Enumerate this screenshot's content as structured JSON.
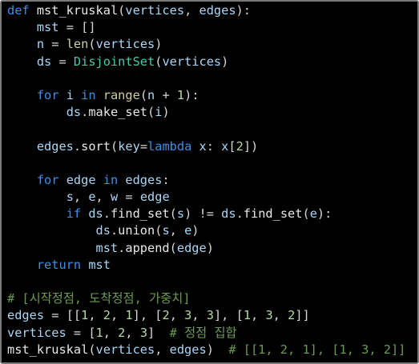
{
  "editor": {
    "lines": [
      [
        [
          "kw",
          "def "
        ],
        [
          "fn",
          "mst_kruskal"
        ],
        [
          "op",
          "("
        ],
        [
          "id",
          "vertices"
        ],
        [
          "op",
          ", "
        ],
        [
          "id",
          "edges"
        ],
        [
          "op",
          "):"
        ]
      ],
      [
        [
          "op",
          "    "
        ],
        [
          "id",
          "mst"
        ],
        [
          "op",
          " = []"
        ]
      ],
      [
        [
          "op",
          "    "
        ],
        [
          "id",
          "n"
        ],
        [
          "op",
          " = "
        ],
        [
          "bi",
          "len"
        ],
        [
          "op",
          "("
        ],
        [
          "id",
          "vertices"
        ],
        [
          "op",
          ")"
        ]
      ],
      [
        [
          "op",
          "    "
        ],
        [
          "id",
          "ds"
        ],
        [
          "op",
          " = "
        ],
        [
          "cls",
          "DisjointSet"
        ],
        [
          "op",
          "("
        ],
        [
          "id",
          "vertices"
        ],
        [
          "op",
          ")"
        ]
      ],
      [],
      [
        [
          "op",
          "    "
        ],
        [
          "kw",
          "for "
        ],
        [
          "id",
          "i"
        ],
        [
          "kw",
          " in "
        ],
        [
          "bi",
          "range"
        ],
        [
          "op",
          "("
        ],
        [
          "id",
          "n"
        ],
        [
          "op",
          " + "
        ],
        [
          "num",
          "1"
        ],
        [
          "op",
          "):"
        ]
      ],
      [
        [
          "op",
          "        "
        ],
        [
          "id",
          "ds"
        ],
        [
          "op",
          "."
        ],
        [
          "fn",
          "make_set"
        ],
        [
          "op",
          "("
        ],
        [
          "id",
          "i"
        ],
        [
          "op",
          ")"
        ]
      ],
      [],
      [
        [
          "op",
          "    "
        ],
        [
          "id",
          "edges"
        ],
        [
          "op",
          "."
        ],
        [
          "fn",
          "sort"
        ],
        [
          "op",
          "("
        ],
        [
          "id",
          "key"
        ],
        [
          "op",
          "="
        ],
        [
          "kw",
          "lambda "
        ],
        [
          "id",
          "x"
        ],
        [
          "op",
          ": "
        ],
        [
          "id",
          "x"
        ],
        [
          "op",
          "["
        ],
        [
          "num",
          "2"
        ],
        [
          "op",
          "])"
        ]
      ],
      [],
      [
        [
          "op",
          "    "
        ],
        [
          "kw",
          "for "
        ],
        [
          "id",
          "edge"
        ],
        [
          "kw",
          " in "
        ],
        [
          "id",
          "edges"
        ],
        [
          "op",
          ":"
        ]
      ],
      [
        [
          "op",
          "        "
        ],
        [
          "id",
          "s"
        ],
        [
          "op",
          ", "
        ],
        [
          "id",
          "e"
        ],
        [
          "op",
          ", "
        ],
        [
          "id",
          "w"
        ],
        [
          "op",
          " = "
        ],
        [
          "id",
          "edge"
        ]
      ],
      [
        [
          "op",
          "        "
        ],
        [
          "kw",
          "if "
        ],
        [
          "id",
          "ds"
        ],
        [
          "op",
          "."
        ],
        [
          "fn",
          "find_set"
        ],
        [
          "op",
          "("
        ],
        [
          "id",
          "s"
        ],
        [
          "op",
          ") != "
        ],
        [
          "id",
          "ds"
        ],
        [
          "op",
          "."
        ],
        [
          "fn",
          "find_set"
        ],
        [
          "op",
          "("
        ],
        [
          "id",
          "e"
        ],
        [
          "op",
          "):"
        ]
      ],
      [
        [
          "op",
          "            "
        ],
        [
          "id",
          "ds"
        ],
        [
          "op",
          "."
        ],
        [
          "fn",
          "union"
        ],
        [
          "op",
          "("
        ],
        [
          "id",
          "s"
        ],
        [
          "op",
          ", "
        ],
        [
          "id",
          "e"
        ],
        [
          "op",
          ")"
        ]
      ],
      [
        [
          "op",
          "            "
        ],
        [
          "id",
          "mst"
        ],
        [
          "op",
          "."
        ],
        [
          "fn",
          "append"
        ],
        [
          "op",
          "("
        ],
        [
          "id",
          "edge"
        ],
        [
          "op",
          ")"
        ]
      ],
      [
        [
          "op",
          "    "
        ],
        [
          "kw",
          "return "
        ],
        [
          "id",
          "mst"
        ]
      ],
      [],
      [
        [
          "cm",
          "# [시작정점, 도착정점, 가중치]"
        ]
      ],
      [
        [
          "id",
          "edges"
        ],
        [
          "op",
          " = [["
        ],
        [
          "num",
          "1"
        ],
        [
          "op",
          ", "
        ],
        [
          "num",
          "2"
        ],
        [
          "op",
          ", "
        ],
        [
          "num",
          "1"
        ],
        [
          "op",
          "], ["
        ],
        [
          "num",
          "2"
        ],
        [
          "op",
          ", "
        ],
        [
          "num",
          "3"
        ],
        [
          "op",
          ", "
        ],
        [
          "num",
          "3"
        ],
        [
          "op",
          "], ["
        ],
        [
          "num",
          "1"
        ],
        [
          "op",
          ", "
        ],
        [
          "num",
          "3"
        ],
        [
          "op",
          ", "
        ],
        [
          "num",
          "2"
        ],
        [
          "op",
          "]]"
        ]
      ],
      [
        [
          "id",
          "vertices"
        ],
        [
          "op",
          " = ["
        ],
        [
          "num",
          "1"
        ],
        [
          "op",
          ", "
        ],
        [
          "num",
          "2"
        ],
        [
          "op",
          ", "
        ],
        [
          "num",
          "3"
        ],
        [
          "op",
          "]  "
        ],
        [
          "cm",
          "# 정점 집합"
        ]
      ],
      [
        [
          "fn",
          "mst_kruskal"
        ],
        [
          "op",
          "("
        ],
        [
          "id",
          "vertices"
        ],
        [
          "op",
          ", "
        ],
        [
          "id",
          "edges"
        ],
        [
          "op",
          ")  "
        ],
        [
          "cm",
          "# [[1, 2, 1], [1, 3, 2]]"
        ]
      ]
    ]
  }
}
